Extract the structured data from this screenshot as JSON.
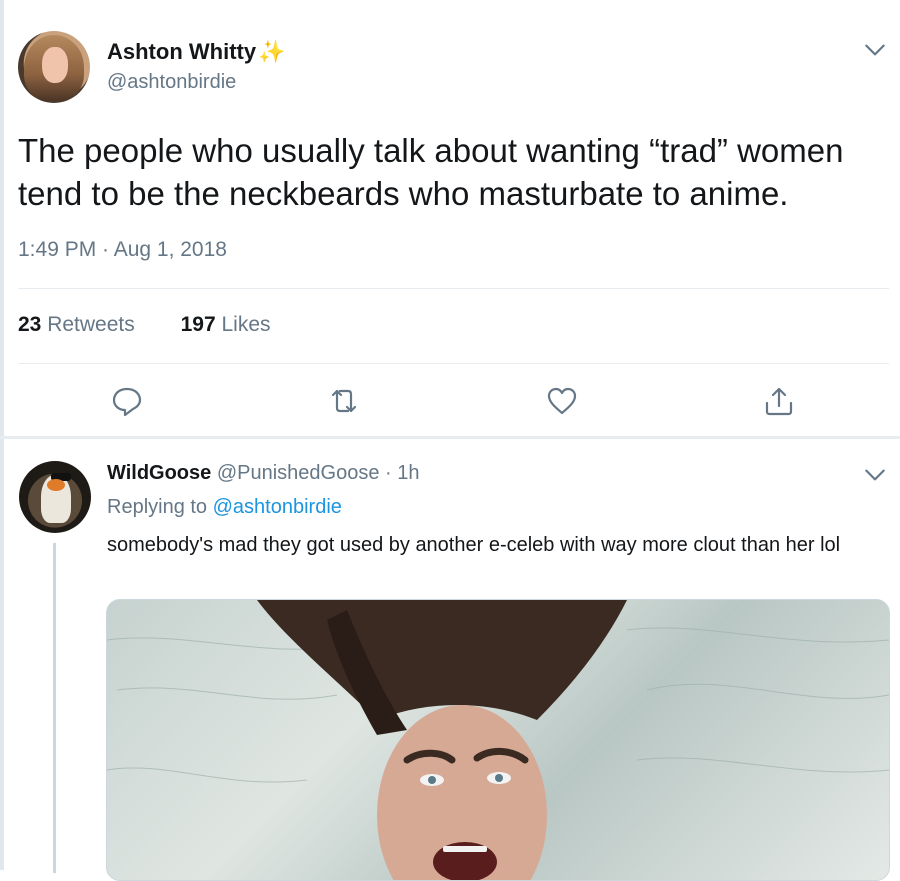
{
  "main_tweet": {
    "author": {
      "name": "Ashton Whitty",
      "badge": "✨",
      "handle": "@ashtonbirdie"
    },
    "text": "The people who usually talk about wanting “trad” women tend to be the neckbeards who masturbate to anime.",
    "timestamp": "1:49 PM · Aug 1, 2018",
    "stats": {
      "retweets_count": "23",
      "retweets_label": "Retweets",
      "likes_count": "197",
      "likes_label": "Likes"
    },
    "actions": [
      "reply-icon",
      "retweet-icon",
      "like-icon",
      "share-icon"
    ]
  },
  "reply": {
    "author": {
      "name": "WildGoose",
      "handle": "@PunishedGoose",
      "time": "· 1h"
    },
    "replying_prefix": "Replying to",
    "replying_to": "@ashtonbirdie",
    "text": "somebody's mad they got used by another e-celeb with way more clout than her lol"
  },
  "colors": {
    "text_primary": "#14171a",
    "text_secondary": "#657786",
    "link": "#1b95e0",
    "divider": "#e6ecf0"
  }
}
